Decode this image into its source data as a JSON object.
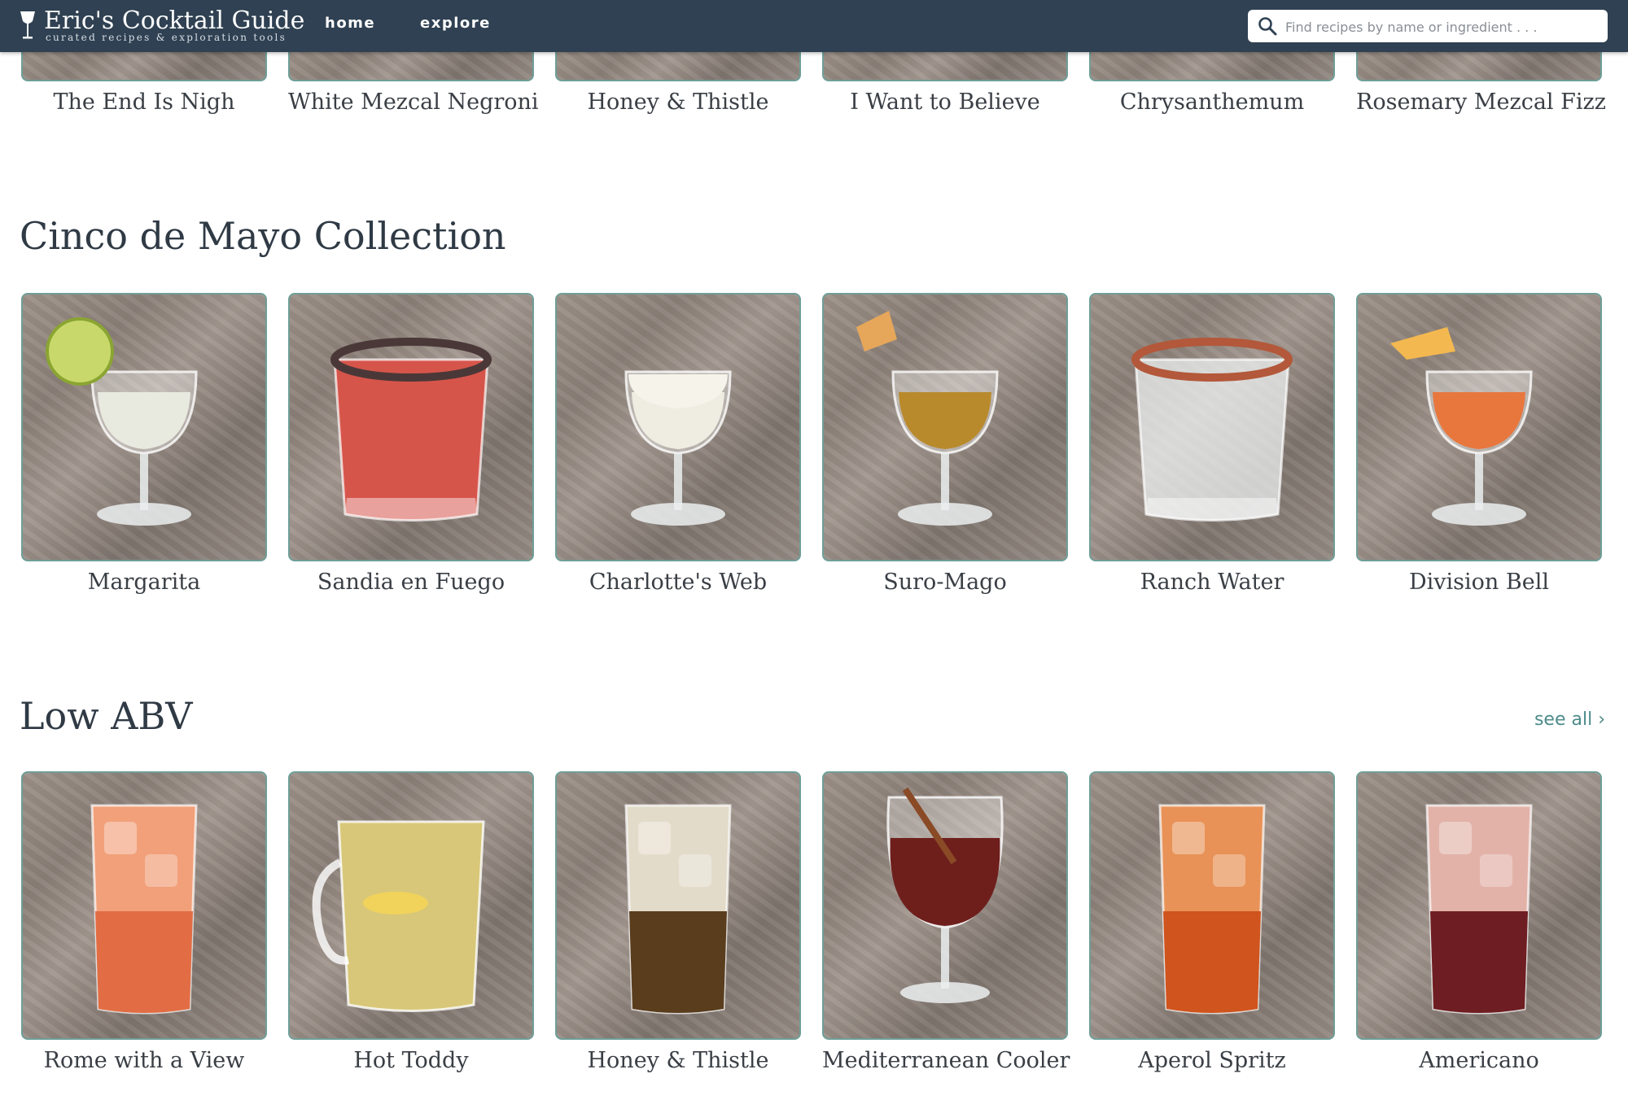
{
  "header": {
    "title": "Eric's Cocktail Guide",
    "subtitle": "curated recipes & exploration tools",
    "nav": [
      "home",
      "explore"
    ],
    "search_placeholder": "Find recipes by name or ingredient . . ."
  },
  "colors": {
    "navbar": "#2f4152",
    "card_border": "#6f9e98",
    "link": "#4d8b8a"
  },
  "top_row": {
    "items": [
      "The End Is Nigh",
      "White Mezcal Negroni",
      "Honey & Thistle",
      "I Want to Believe",
      "Chrysanthemum",
      "Rosemary Mezcal Fizz"
    ]
  },
  "sections": [
    {
      "title": "Cinco de Mayo Collection",
      "see_all": "",
      "items": [
        {
          "name": "Margarita",
          "drink": "margarita"
        },
        {
          "name": "Sandia en Fuego",
          "drink": "rocks-red"
        },
        {
          "name": "Charlotte's Web",
          "drink": "coupe-white"
        },
        {
          "name": "Suro-Mago",
          "drink": "coupe-amber"
        },
        {
          "name": "Ranch Water",
          "drink": "rocks-clear"
        },
        {
          "name": "Division Bell",
          "drink": "coupe-orange"
        }
      ]
    },
    {
      "title": "Low ABV",
      "see_all": "see all",
      "items": [
        {
          "name": "Rome with a View",
          "drink": "collins-orange"
        },
        {
          "name": "Hot Toddy",
          "drink": "mug"
        },
        {
          "name": "Honey & Thistle",
          "drink": "collins-brown"
        },
        {
          "name": "Mediterranean Cooler",
          "drink": "wine-red"
        },
        {
          "name": "Aperol Spritz",
          "drink": "collins-aperol"
        },
        {
          "name": "Americano",
          "drink": "collins-red"
        }
      ]
    }
  ]
}
